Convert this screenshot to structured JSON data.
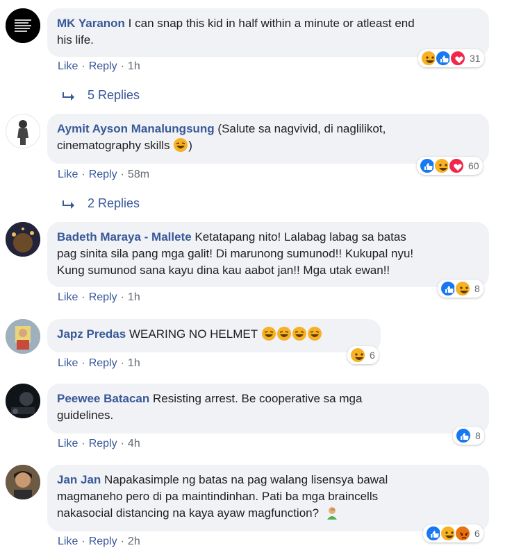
{
  "comments": [
    {
      "author": "MK Yaranon",
      "text_1": "I can snap this kid in half within a minute or atleast end",
      "text_2": "his life.",
      "like": "Like",
      "reply": "Reply",
      "time": "1h",
      "reaction_count": "31",
      "reactions": [
        "haha",
        "like",
        "love"
      ],
      "replies_label": "5 Replies",
      "avatar_text": "DARKNESS CANNOT DRIVE OUT DARKNESS ONLY LIGHT CAN DO THAT"
    },
    {
      "author": "Aymit Ayson Manalungsung",
      "text_1": "(Salute sa nagvivid, di naglilikot,",
      "text_2": "cinematography skills",
      "text_3": ")",
      "like": "Like",
      "reply": "Reply",
      "time": "58m",
      "reaction_count": "60",
      "reactions": [
        "like",
        "haha",
        "love"
      ],
      "replies_label": "2 Replies"
    },
    {
      "author": "Badeth Maraya - Mallete",
      "text_1": "Ketatapang nito! Lalabag labag sa batas",
      "text_2": "pag sinita sila pang mga galit! Di marunong sumunod!! Kukupal nyu!",
      "text_3": "Kung sumunod sana kayu dina kau aabot jan!! Mga utak ewan!!",
      "like": "Like",
      "reply": "Reply",
      "time": "1h",
      "reaction_count": "8",
      "reactions": [
        "like",
        "haha"
      ]
    },
    {
      "author": "Japz Predas",
      "text_1": "WEARING NO HELMET",
      "like": "Like",
      "reply": "Reply",
      "time": "1h",
      "reaction_count": "6",
      "reactions": [
        "haha"
      ]
    },
    {
      "author": "Peewee Batacan",
      "text_1": "Resisting arrest. Be cooperative sa mga",
      "text_2": "guidelines.",
      "like": "Like",
      "reply": "Reply",
      "time": "4h",
      "reaction_count": "8",
      "reactions": [
        "like"
      ]
    },
    {
      "author": "Jan Jan",
      "text_1": "Napakasimple ng batas na pag walang lisensya bawal",
      "text_2": "magmaneho pero di pa maintindinhan. Pati ba mga braincells",
      "text_3": "nakasocial distancing na kaya ayaw magfunction?",
      "like": "Like",
      "reply": "Reply",
      "time": "2h",
      "reaction_count": "6",
      "reactions": [
        "like",
        "haha",
        "angry"
      ]
    }
  ],
  "colors": {
    "link": "#385898",
    "bubble": "#f0f2f5",
    "like": "#1877f2",
    "haha": "#f7b125",
    "love": "#f02849",
    "angry": "#e9710f"
  }
}
